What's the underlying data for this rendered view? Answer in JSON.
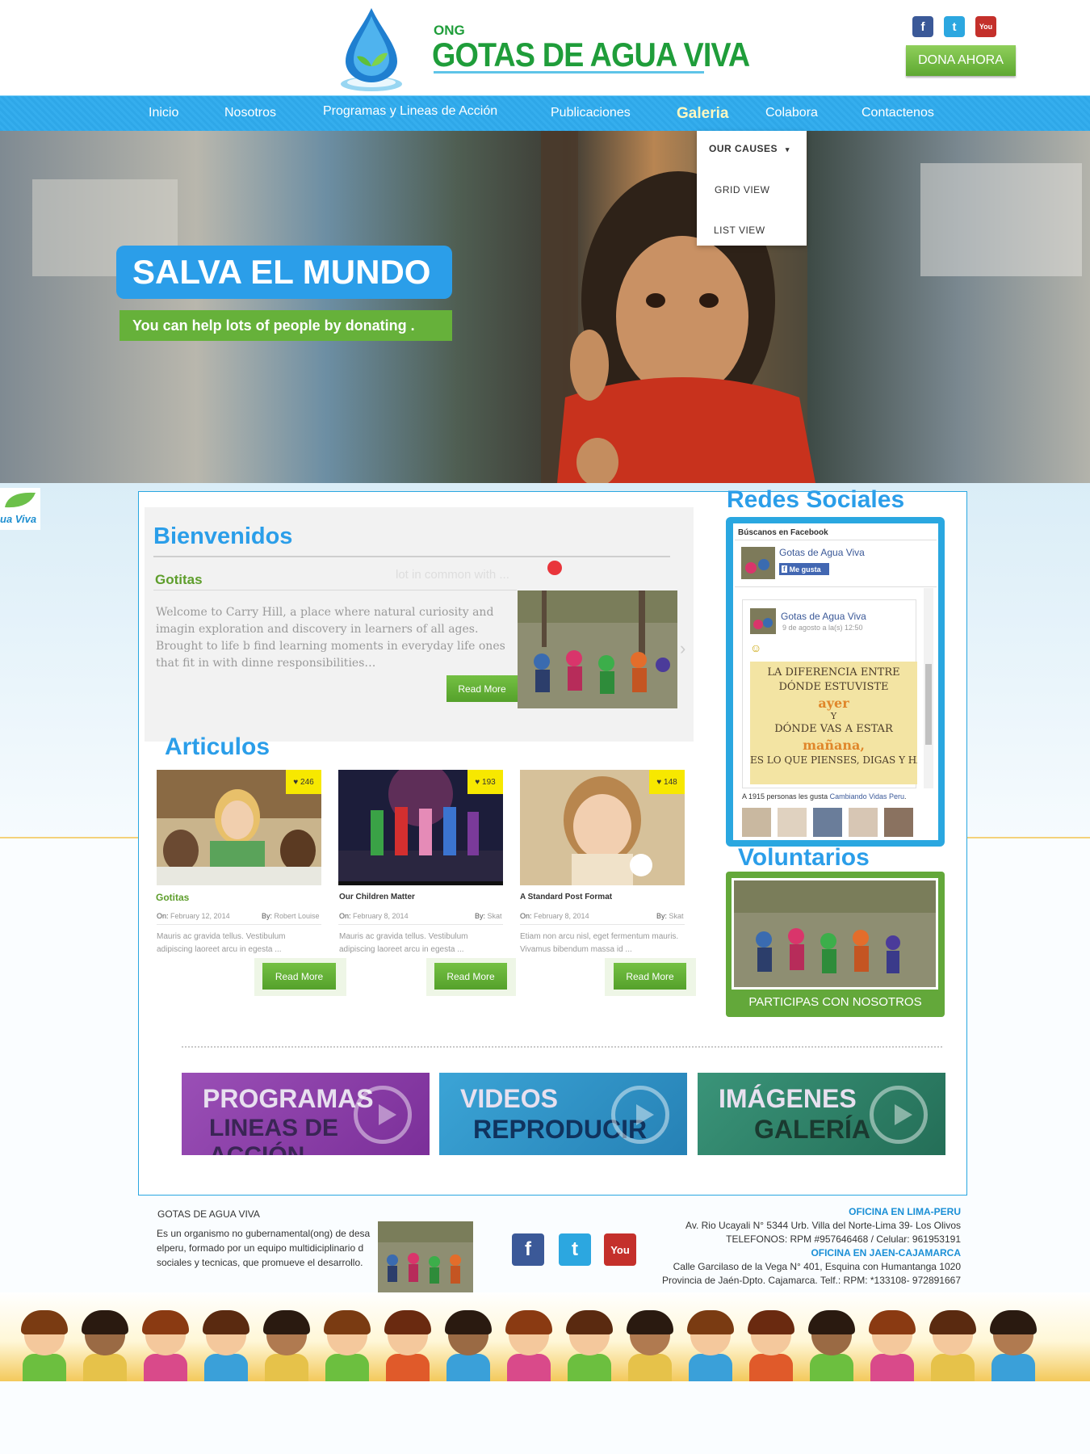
{
  "header": {
    "logo_prefix": "ONG",
    "logo_title": "GOTAS DE AGUA VIVA",
    "social": [
      {
        "icon": "facebook-icon",
        "glyph": "f",
        "color": "#3b5998"
      },
      {
        "icon": "twitter-icon",
        "glyph": "t",
        "color": "#2ca7e0"
      },
      {
        "icon": "youtube-icon",
        "glyph": "You",
        "color": "#c4302b"
      }
    ],
    "donate_label": "DONA AHORA"
  },
  "nav": {
    "items": [
      "Inicio",
      "Nosotros",
      "Programas y Lineas de Acción",
      "Publicaciones",
      "Galeria",
      "Colabora",
      "Contactenos"
    ],
    "active": "Galeria",
    "dropdown": [
      "OUR CAUSES",
      "GRID VIEW",
      "LIST VIEW"
    ],
    "dropdown_arrow": "▾"
  },
  "hero": {
    "title": "SALVA EL MUNDO",
    "subtitle": "You can help lots of people by donating ."
  },
  "side_tab": {
    "label": "ua Viva"
  },
  "welcome": {
    "heading": "Bienvenidos",
    "subheading": "Gotitas",
    "faded_text": "lot in common with ...",
    "body": "Welcome to Carry Hill, a place where natural curiosity and imagin exploration and discovery in learners of all ages. Brought to life b find learning moments in everyday life ones that fit in with dinne responsibilities…",
    "button": "Read More"
  },
  "articles": {
    "heading": "Articulos",
    "items": [
      {
        "likes": "246",
        "title": "Gotitas",
        "date": "February 12, 2014",
        "author": "Robert Louise",
        "excerpt": "Mauris ac gravida tellus. Vestibulum adipiscing laoreet arcu in egesta ...",
        "button": "Read More"
      },
      {
        "likes": "193",
        "title": "Our Children Matter",
        "date": "February 8, 2014",
        "author": "Skat",
        "excerpt": "Mauris ac gravida tellus. Vestibulum adipiscing laoreet arcu in egesta ...",
        "button": "Read More"
      },
      {
        "likes": "148",
        "title": "A Standard Post Format",
        "date": "February 8, 2014",
        "author": "Skat",
        "excerpt": "Etiam non arcu nisl, eget fermentum mauris. Vivamus bibendum massa id ...",
        "button": "Read More"
      }
    ],
    "on_label": "On:",
    "by_label": "By:"
  },
  "sidebar": {
    "redes_heading": "Redes Sociales",
    "fb_box_title": "Búscanos en Facebook",
    "fb_page_name": "Gotas de Agua Viva",
    "fb_like": "Me gusta",
    "fb_post_name": "Gotas de Agua Viva",
    "fb_post_date": "9 de agosto a la(s) 12:50",
    "fb_post_emoji": "☺",
    "poster_lines": [
      "LA DIFERENCIA ENTRE",
      "DÓNDE ESTUVISTE",
      "ayer",
      "Y",
      "DÓNDE VAS A ESTAR",
      "mañana,",
      "ES LO QUE PIENSES, DIGAS Y HAGAS"
    ],
    "fb_footer_prefix": "A 1915 personas les gusta",
    "fb_footer_link": "Cambiando Vidas Peru",
    "fb_footer_suffix": ".",
    "voluntarios_heading": "Voluntarios",
    "voluntarios_label": "PARTICIPAS CON NOSOTROS"
  },
  "banners": [
    {
      "line1": "PROGRAMAS",
      "line2": "LINEAS DE ACCIÓN",
      "color": "#8a3fa6"
    },
    {
      "line1": "VIDEOS",
      "line2": "REPRODUCIR",
      "color": "#2f8fc4"
    },
    {
      "line1": "IMÁGENES",
      "line2": "GALERÍA",
      "color": "#2e7c66"
    }
  ],
  "footer": {
    "about_title": "GOTAS DE AGUA VIVA",
    "about_lines": [
      "Es un organismo no gubernamental(ong) de desa",
      "elperu, formado por un equipo multidiciplinario d",
      "sociales y tecnicas, que promueve el desarrollo."
    ],
    "social": [
      {
        "icon": "facebook-icon",
        "glyph": "f",
        "color": "#3b5998"
      },
      {
        "icon": "twitter-icon",
        "glyph": "t",
        "color": "#2ca7e0"
      },
      {
        "icon": "youtube-icon",
        "glyph": "You",
        "color": "#c4302b"
      }
    ],
    "office1_title": "OFICINA EN LIMA-PERU",
    "office1_lines": [
      "Av. Rio Ucayali N° 5344 Urb. Villa del Norte-Lima 39- Los Olivos",
      "TELEFONOS: RPM #957646468 / Celular: 961953191"
    ],
    "office2_title": "OFICINA EN JAEN-CAJAMARCA",
    "office2_lines": [
      "Calle Garcilaso de la Vega N° 401, Esquina con Humantanga 1020",
      "Provincia de Jaén-Dpto. Cajamarca. Telf.: RPM: *133108- 972891667"
    ]
  }
}
